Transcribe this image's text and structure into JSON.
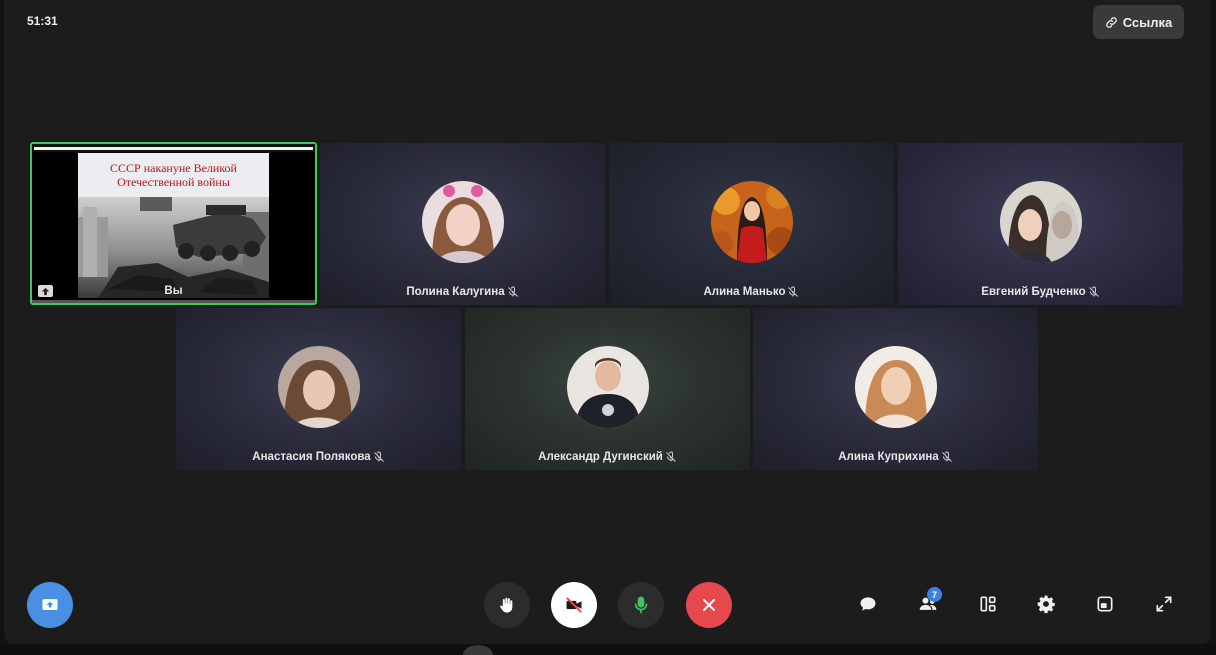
{
  "call": {
    "timer": "51:31",
    "link_label": "Ссылка"
  },
  "self": {
    "name": "Вы",
    "slide_line1": "СССР накануне Великой",
    "slide_line2": "Отечественной войны"
  },
  "participants": [
    {
      "name": "Полина Калугина"
    },
    {
      "name": "Алина Манько"
    },
    {
      "name": "Евгений Будченко"
    },
    {
      "name": "Анастасия Полякова"
    },
    {
      "name": "Александр Дугинский"
    },
    {
      "name": "Алина Куприхина"
    }
  ],
  "toolbar": {
    "participants_count": "7"
  },
  "colors": {
    "self_border": "#3ec95a",
    "share_button": "#4a90e2",
    "end_call": "#e5484d",
    "mic_active": "#43c463",
    "badge": "#3b82e0"
  },
  "icons": [
    "link-icon",
    "mic-off-icon",
    "screen-share-icon",
    "raise-hand-icon",
    "camera-off-icon",
    "mic-icon",
    "end-call-icon",
    "chat-icon",
    "participants-icon",
    "layout-icon",
    "settings-icon",
    "pip-icon",
    "fullscreen-icon"
  ]
}
